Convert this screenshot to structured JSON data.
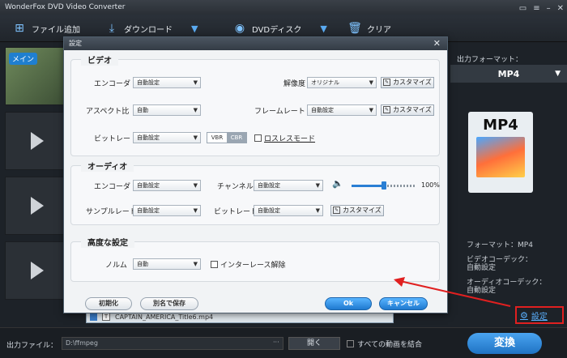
{
  "app": {
    "title": "WonderFox DVD Video Converter",
    "toolbar": {
      "add_file": "ファイル追加",
      "download": "ダウンロード",
      "dvd_disc": "DVDディスク",
      "clear": "クリア"
    },
    "main_tag": "メイン",
    "output_format_label": "出力フォーマット：",
    "output_format_value": "MP4",
    "mp4_badge": "MP4",
    "meta": {
      "format": "フォーマット：MP4",
      "video_codec": "ビデオコーデック：",
      "video_codec_value": "自動設定",
      "audio_codec": "オーディオコーデック：",
      "audio_codec_value": "自動設定"
    },
    "settings_link": "設定",
    "file_item": "CAPTAIN_AMERICA_Title6.mp4",
    "bottom": {
      "output_file_label": "出力ファイル：",
      "output_path": "D:\\ffmpeg",
      "dots": "···",
      "open": "開く",
      "merge_all": "すべての動画を結合",
      "convert": "変換"
    }
  },
  "dialog": {
    "title": "設定",
    "close": "✕",
    "video": {
      "title": "ビデオ",
      "encoder_label": "エンコーダ",
      "encoder_value": "自動設定",
      "resolution_label": "解像度",
      "resolution_value": "オリジナル",
      "customize": "カスタマイズ",
      "aspect_label": "アスペクト比",
      "aspect_value": "自動",
      "framerate_label": "フレームレート",
      "framerate_value": "自動設定",
      "bitrate_label": "ビットレート",
      "bitrate_value": "自動設定",
      "vbr": "VBR",
      "cbr": "CBR",
      "lossless": "ロスレスモード"
    },
    "audio": {
      "title": "オーディオ",
      "encoder_label": "エンコーダ",
      "encoder_value": "自動設定",
      "channel_label": "チャンネル",
      "channel_value": "自動設定",
      "volume_pct": "100%",
      "volume_level": 0.5,
      "samplerate_label": "サンプルレート",
      "samplerate_value": "自動設定",
      "bitrate_label": "ビットレート",
      "bitrate_value": "自動設定",
      "customize": "カスタマイズ"
    },
    "advanced": {
      "title": "高度な設定",
      "norm_label": "ノルム",
      "norm_value": "自動",
      "deinterlace": "インターレース解除"
    },
    "buttons": {
      "reset": "初期化",
      "save_as": "別名で保存",
      "ok": "Ok",
      "cancel": "キャンセル"
    }
  },
  "colors": {
    "accent_blue": "#1f7ad0",
    "highlight_red": "#e02020"
  }
}
